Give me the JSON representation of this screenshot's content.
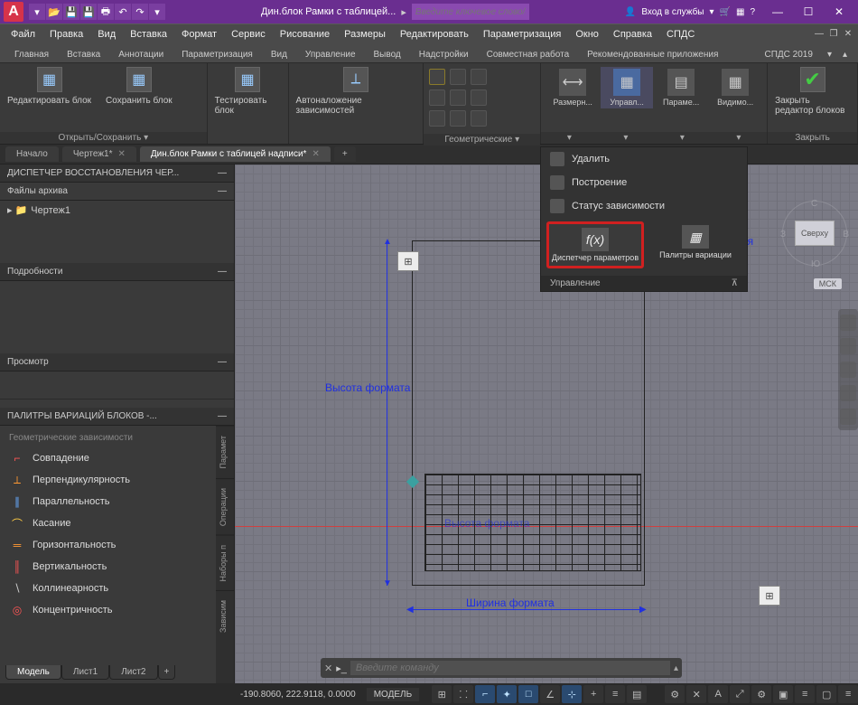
{
  "title": "Дин.блок Рамки с таблицей...",
  "search_placeholder": "Введите ключевое слово/фразу",
  "signin": "Вход в службы",
  "menus": [
    "Файл",
    "Правка",
    "Вид",
    "Вставка",
    "Формат",
    "Сервис",
    "Рисование",
    "Размеры",
    "Редактировать",
    "Параметризация",
    "Окно",
    "Справка",
    "СПДС"
  ],
  "ribbon_tabs": [
    "Главная",
    "Вставка",
    "Аннотации",
    "Параметризация",
    "Вид",
    "Управление",
    "Вывод",
    "Надстройки",
    "Совместная работа",
    "Рекомендованные приложения",
    "СПДС 2019"
  ],
  "ribbon": {
    "edit": "Редактировать блок",
    "save": "Сохранить блок",
    "test": "Тестировать блок",
    "auto": "Автоналожение зависимостей",
    "open_save": "Открыть/Сохранить",
    "geom": "Геометрические",
    "dim": "Размерн...",
    "manage": "Управл...",
    "param": "Параме...",
    "vis": "Видимо...",
    "close": "Закрыть редактор блоков",
    "closetab": "Закрыть"
  },
  "doc_tabs": {
    "start": "Начало",
    "d1": "Чертеж1*",
    "d2": "Дин.блок Рамки с таблицей надписи*"
  },
  "left": {
    "recover": "ДИСПЕТЧЕР ВОССТАНОВЛЕНИЯ ЧЕР...",
    "arch": "Файлы архива",
    "file": "Чертеж1",
    "details": "Подробности",
    "preview": "Просмотр",
    "pal2": "ПАЛИТРЫ ВАРИАЦИЙ БЛОКОВ -...",
    "sub": "Геометрические зависимости",
    "c1": "Совпадение",
    "c2": "Перпендикулярность",
    "c3": "Параллельность",
    "c4": "Касание",
    "c5": "Горизонтальность",
    "c6": "Вертикальность",
    "c7": "Коллинеарность",
    "c8": "Концентричность",
    "t1": "Парамет",
    "t2": "Операции",
    "t3": "Наборы п",
    "t4": "Зависим"
  },
  "canvas": {
    "w": "Ширина формата",
    "h": "Высота формата",
    "w2": "Высота формата",
    "num": "Сквозная нумерация",
    "vc_face": "Сверху",
    "wcs": "МСК",
    "dirs": {
      "n": "С",
      "e": "В",
      "s": "Ю",
      "w": "З"
    }
  },
  "dropdown": {
    "del": "Удалить",
    "build": "Построение",
    "status": "Статус зависимости",
    "disp": "Диспетчер параметров",
    "pal": "Палитры вариации",
    "foot": "Управление"
  },
  "cmd_placeholder": "Введите команду",
  "modeltabs": {
    "m": "Модель",
    "l1": "Лист1",
    "l2": "Лист2"
  },
  "status": {
    "coords": "-190.8060, 222.9118, 0.0000",
    "model": "МОДЕЛЬ"
  }
}
